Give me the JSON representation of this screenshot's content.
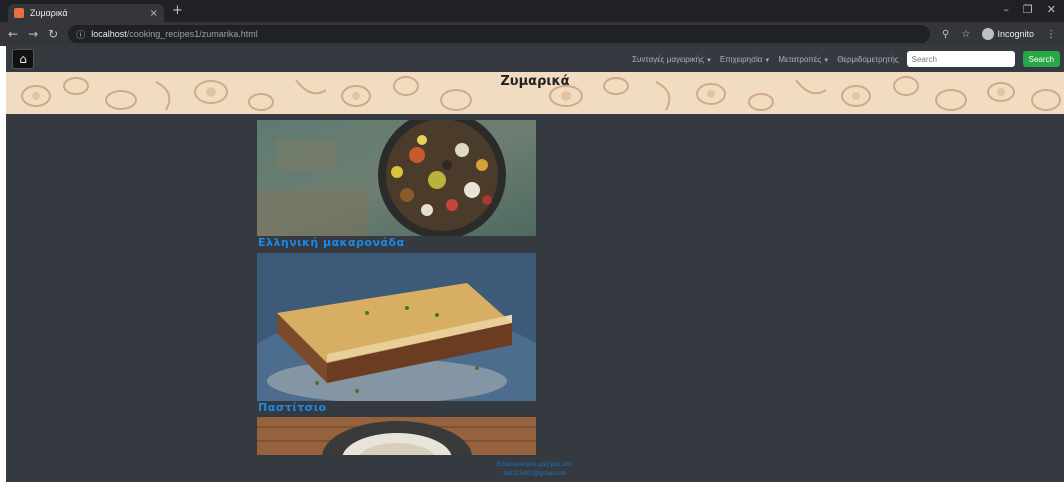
{
  "browser": {
    "tab_title": "Ζυμαρικά",
    "tab_close": "×",
    "new_tab": "+",
    "url_host": "localhost",
    "url_path": "/cooking_recipes1/zumarika.html",
    "incognito_label": "Incognito"
  },
  "navbar": {
    "menu": [
      {
        "label": "Συνταγές μαγειρικής"
      },
      {
        "label": "Επιχειρησία"
      },
      {
        "label": "Μετατροπές"
      }
    ],
    "link": "Θερμιδομετρητής",
    "search_placeholder": "Search",
    "search_button": "Search"
  },
  "banner": {
    "title": "Ζυμαρικά"
  },
  "recipes": [
    {
      "title": "Ελληνική μακαρονάδα"
    },
    {
      "title": "Παστίτσιο"
    }
  ],
  "footer": {
    "line1": "Επικοινωνήστε μαζί μας στο:",
    "line2": "tel1315007@gmail.com"
  }
}
